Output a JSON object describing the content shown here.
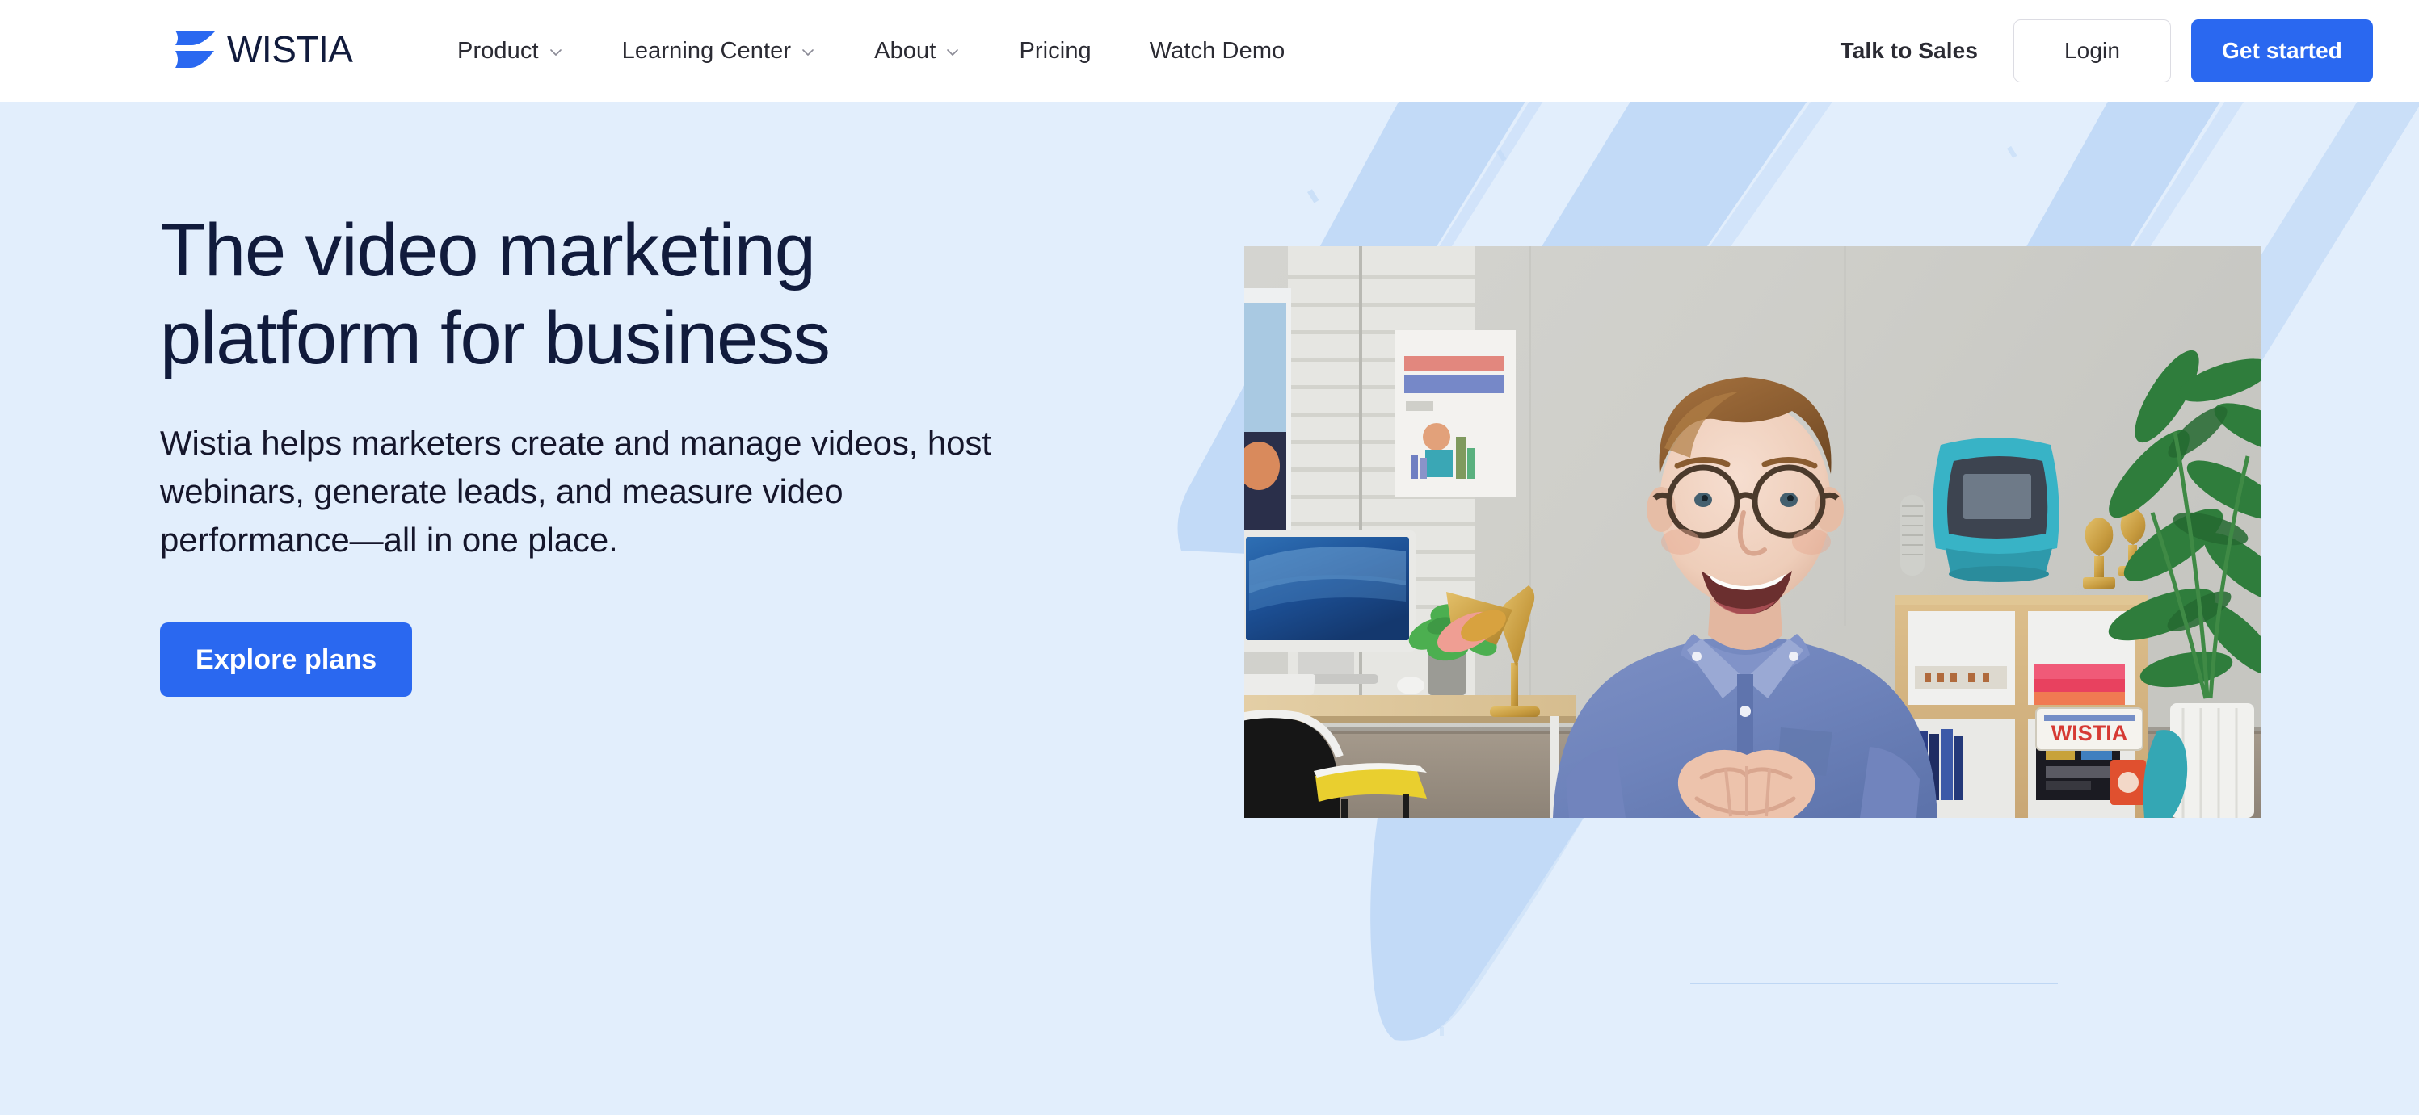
{
  "brand": {
    "name": "WISTIA",
    "logo_icon": "wistia-wave-logo",
    "accent_blue": "#2a68f0",
    "logo_navy": "#111b3c",
    "hero_bg": "#e2eefc",
    "brush_blue": "#c2daf7"
  },
  "header": {
    "nav": [
      {
        "label": "Product",
        "icon": "chevron-down-icon",
        "has_menu": true
      },
      {
        "label": "Learning Center",
        "icon": "chevron-down-icon",
        "has_menu": true
      },
      {
        "label": "About",
        "icon": "chevron-down-icon",
        "has_menu": true
      },
      {
        "label": "Pricing",
        "has_menu": false
      },
      {
        "label": "Watch Demo",
        "has_menu": false
      }
    ],
    "talk_to_sales": "Talk to Sales",
    "login": "Login",
    "get_started": "Get started"
  },
  "hero": {
    "title": "The video marketing\nplatform for business",
    "subtitle": "Wistia helps marketers create and manage videos, host webinars, generate leads, and measure video performance—all in one place.",
    "cta": "Explore plans",
    "media_alt": "Smiling man in a blue button-down shirt standing in a bright office with a desk, iMac, gold lamp, plant and bookshelf"
  }
}
